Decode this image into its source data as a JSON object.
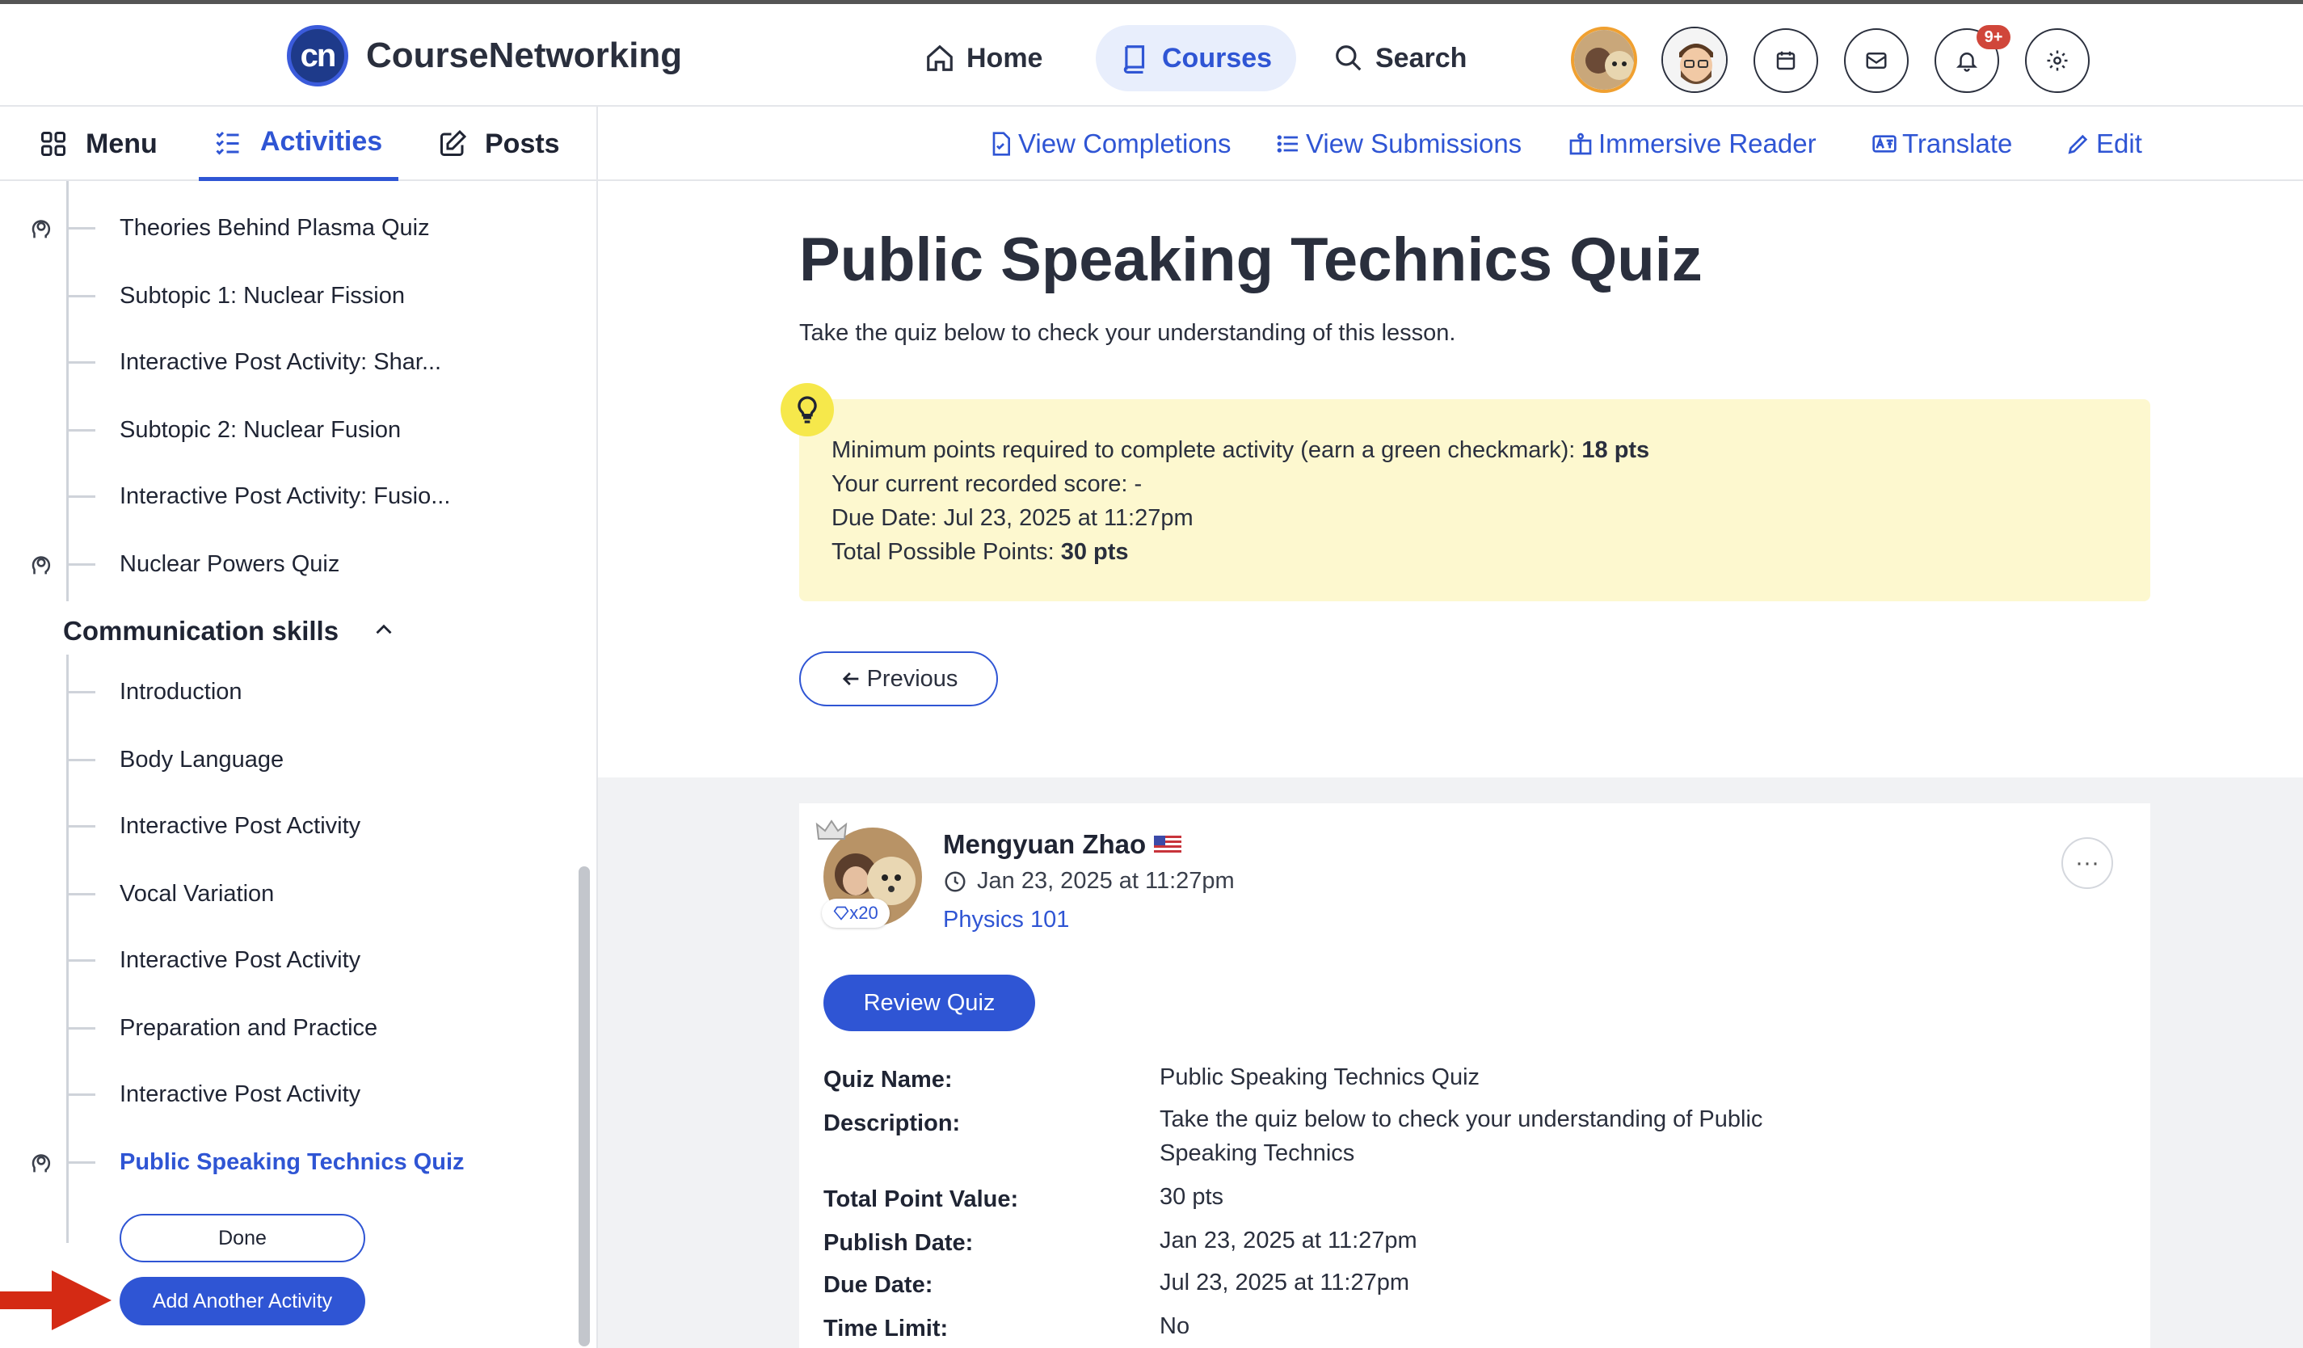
{
  "header": {
    "logo_mark": "cn",
    "brand": "CourseNetworking",
    "nav": [
      {
        "label": "Home",
        "icon": "home-icon"
      },
      {
        "label": "Courses",
        "icon": "book-icon",
        "active": true
      },
      {
        "label": "Search",
        "icon": "search-icon"
      }
    ],
    "notification_badge": "9+"
  },
  "subbar": {
    "tabs": [
      {
        "label": "Menu",
        "icon": "grid-icon"
      },
      {
        "label": "Activities",
        "icon": "checklist-icon",
        "active": true
      },
      {
        "label": "Posts",
        "icon": "edit-icon"
      }
    ],
    "actions": [
      {
        "label": "View Completions",
        "icon": "document-check-icon"
      },
      {
        "label": "View Submissions",
        "icon": "list-icon"
      },
      {
        "label": "Immersive Reader",
        "icon": "reader-icon"
      },
      {
        "label": "Translate",
        "icon": "translate-icon"
      },
      {
        "label": "Edit",
        "icon": "pencil-icon"
      }
    ]
  },
  "sidebar": {
    "items_top": [
      {
        "label": "Theories Behind Plasma Quiz",
        "quiz": true
      },
      {
        "label": "Subtopic 1: Nuclear Fission",
        "quiz": false
      },
      {
        "label": "Interactive Post Activity: Shar...",
        "quiz": false
      },
      {
        "label": "Subtopic 2: Nuclear Fusion",
        "quiz": false
      },
      {
        "label": "Interactive Post Activity: Fusio...",
        "quiz": false
      },
      {
        "label": "Nuclear Powers Quiz",
        "quiz": true
      }
    ],
    "section_title": "Communication skills",
    "items_section": [
      {
        "label": "Introduction",
        "quiz": false
      },
      {
        "label": "Body Language",
        "quiz": false
      },
      {
        "label": "Interactive Post Activity",
        "quiz": false
      },
      {
        "label": "Vocal Variation",
        "quiz": false
      },
      {
        "label": "Interactive Post Activity",
        "quiz": false
      },
      {
        "label": "Preparation and Practice",
        "quiz": false
      },
      {
        "label": "Interactive Post Activity",
        "quiz": false
      },
      {
        "label": "Public Speaking Technics Quiz",
        "quiz": true,
        "current": true
      }
    ],
    "done_label": "Done",
    "add_label": "Add Another Activity"
  },
  "main": {
    "title": "Public Speaking Technics Quiz",
    "subtitle": "Take the quiz below to check your understanding of this lesson.",
    "info": {
      "min_points_prefix": "Minimum points required to complete activity (earn a green checkmark): ",
      "min_points_value": "18 pts",
      "current_score": "Your current recorded score: -",
      "due_date": "Due Date: Jul 23, 2025 at 11:27pm",
      "total_prefix": "Total Possible Points: ",
      "total_value": "30 pts"
    },
    "previous_label": "Previous"
  },
  "post": {
    "author": "Mengyuan Zhao",
    "gem_count": "x20",
    "date": "Jan 23, 2025 at 11:27pm",
    "course": "Physics 101",
    "more_label": "···",
    "review_label": "Review Quiz",
    "details": [
      {
        "label": "Quiz Name:",
        "value": "Public Speaking Technics Quiz"
      },
      {
        "label": "Description:",
        "value": "Take the quiz below to check your understanding of Public Speaking Technics"
      },
      {
        "label": "Total Point Value:",
        "value": "30 pts"
      },
      {
        "label": "Publish Date:",
        "value": "Jan 23, 2025 at 11:27pm"
      },
      {
        "label": "Due Date:",
        "value": "Jul 23, 2025 at 11:27pm"
      },
      {
        "label": "Time Limit:",
        "value": "No"
      }
    ]
  },
  "colors": {
    "accent": "#2f55d4",
    "info_bg": "#fdf8cf",
    "badge": "#d0463a",
    "arrow": "#d42a14"
  }
}
